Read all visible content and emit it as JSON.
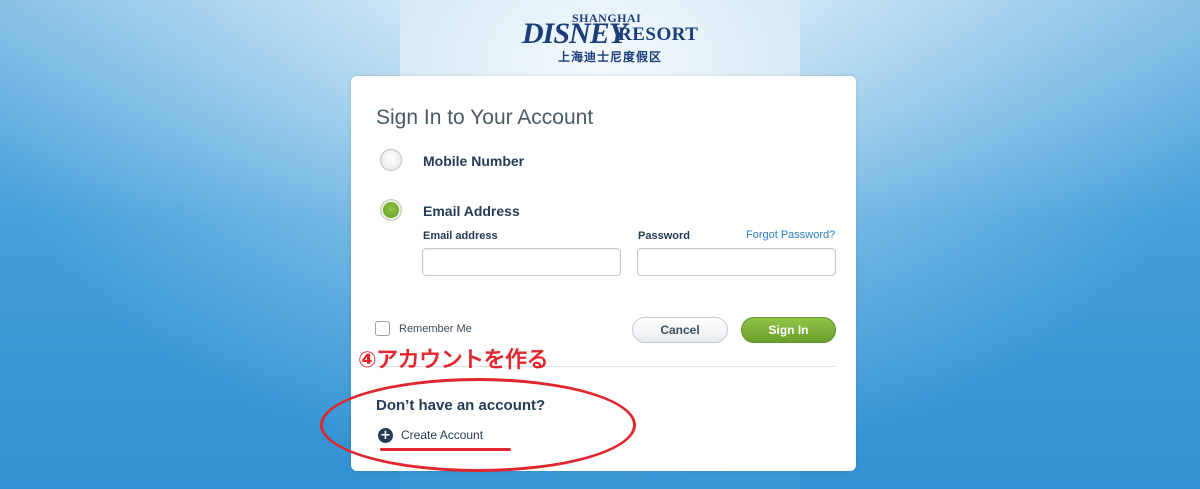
{
  "logo": {
    "shanghai": "SHANGHAI",
    "disney": "DISNEY",
    "resort": "RESORT",
    "chinese": "上海迪士尼度假区"
  },
  "signin": {
    "title": "Sign In to Your Account",
    "options": [
      {
        "label": "Mobile Number",
        "selected": false
      },
      {
        "label": "Email Address",
        "selected": true
      }
    ],
    "email_label": "Email address",
    "email_value": "",
    "password_label": "Password",
    "password_value": "",
    "forgot_link": "Forgot Password?",
    "remember_label": "Remember Me",
    "remember_checked": false,
    "cancel_label": "Cancel",
    "signin_label": "Sign In"
  },
  "create": {
    "prompt": "Don’t have an account?",
    "plus_glyph": "+",
    "link_label": "Create Account"
  },
  "annotation": {
    "text": "④アカウントを作る",
    "color": "#e0262e"
  },
  "colors": {
    "accent_green": "#6aa22a",
    "link_blue": "#2b7fbf",
    "text_navy": "#253b56",
    "background_blue": "#2f8fd2"
  }
}
